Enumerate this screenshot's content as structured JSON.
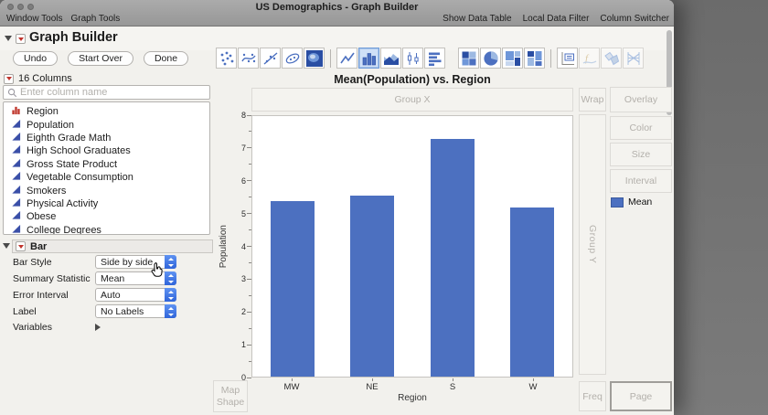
{
  "titlebar": {
    "title": "US Demographics - Graph Builder",
    "menus": [
      "Window Tools",
      "Graph Tools"
    ],
    "right_actions": [
      "Show Data Table",
      "Local Data Filter",
      "Column Switcher"
    ]
  },
  "header": {
    "title": "Graph Builder"
  },
  "actions": {
    "buttons": [
      "Undo",
      "Start Over",
      "Done"
    ]
  },
  "toolbar": {
    "icons": [
      {
        "name": "scatter",
        "group": 1
      },
      {
        "name": "smoother",
        "group": 1
      },
      {
        "name": "line-of-fit",
        "group": 1
      },
      {
        "name": "ellipse",
        "group": 1
      },
      {
        "name": "contour",
        "group": 1
      },
      {
        "name": "line-chart",
        "group": 2
      },
      {
        "name": "bar-chart",
        "group": 2,
        "selected": true
      },
      {
        "name": "area-chart",
        "group": 2
      },
      {
        "name": "box-plot",
        "group": 2
      },
      {
        "name": "bar-horizontal",
        "group": 2
      },
      {
        "name": "heatmap",
        "group": 3
      },
      {
        "name": "pie-chart",
        "group": 3
      },
      {
        "name": "treemap",
        "group": 3
      },
      {
        "name": "mosaic",
        "group": 3
      },
      {
        "name": "caption-box",
        "group": 4
      },
      {
        "name": "formula",
        "group": 4,
        "disabled": true
      },
      {
        "name": "map-shapes",
        "group": 4,
        "disabled": true
      },
      {
        "name": "parallel-plot",
        "group": 4,
        "disabled": true
      }
    ]
  },
  "columns_panel": {
    "count_label": "16 Columns",
    "search_placeholder": "Enter column name",
    "items": [
      {
        "label": "Region",
        "role": "nominal"
      },
      {
        "label": "Population",
        "role": "continuous"
      },
      {
        "label": "Eighth Grade Math",
        "role": "continuous"
      },
      {
        "label": "High School Graduates",
        "role": "continuous"
      },
      {
        "label": "Gross State Product",
        "role": "continuous"
      },
      {
        "label": "Vegetable Consumption",
        "role": "continuous"
      },
      {
        "label": "Smokers",
        "role": "continuous"
      },
      {
        "label": "Physical Activity",
        "role": "continuous"
      },
      {
        "label": "Obese",
        "role": "continuous"
      },
      {
        "label": "College Degrees",
        "role": "continuous"
      }
    ]
  },
  "bar_panel": {
    "title": "Bar",
    "rows": [
      {
        "label": "Bar Style",
        "value": "Side by side"
      },
      {
        "label": "Summary Statistic",
        "value": "Mean"
      },
      {
        "label": "Error Interval",
        "value": "Auto"
      },
      {
        "label": "Label",
        "value": "No Labels"
      }
    ],
    "variables_label": "Variables"
  },
  "chart": {
    "zones": {
      "group_x": "Group X",
      "wrap": "Wrap",
      "overlay": "Overlay",
      "color": "Color",
      "size": "Size",
      "interval": "Interval",
      "group_y": "Group Y",
      "map_shape": "Map Shape",
      "freq": "Freq",
      "page": "Page"
    },
    "legend": {
      "label": "Mean",
      "swatch_color": "#4c70c0"
    }
  },
  "chart_data": {
    "type": "bar",
    "title": "Mean(Population) vs. Region",
    "categories": [
      "MW",
      "NE",
      "S",
      "W"
    ],
    "values": [
      5.4,
      5.55,
      7.3,
      5.2
    ],
    "xlabel": "Region",
    "ylabel": "Population",
    "ylim": [
      0,
      8
    ],
    "ytick_step": 1,
    "bar_color": "#4c70c0",
    "legend_label": "Mean",
    "legend_position": "right",
    "grid": false
  }
}
